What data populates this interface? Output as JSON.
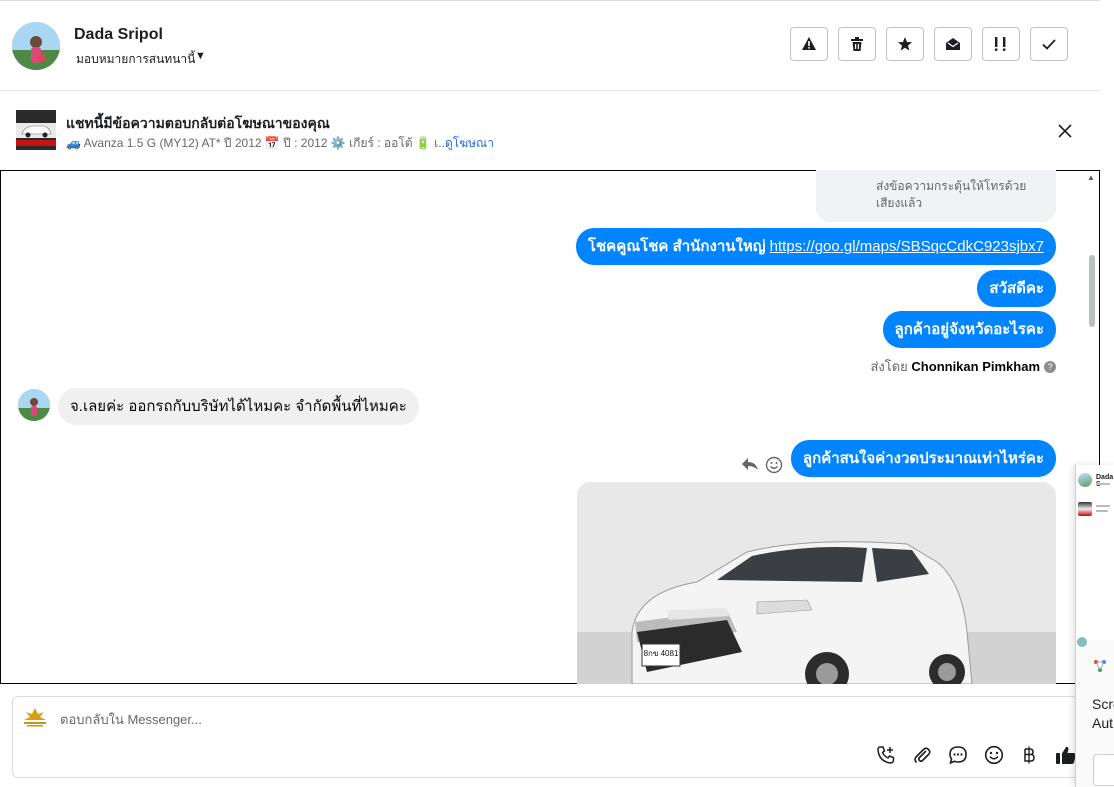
{
  "header": {
    "user_name": "Dada Sripol",
    "assign_label": "มอบหมายการสนทนานี้",
    "toolbar": [
      {
        "name": "spam-button",
        "icon": "warning-icon"
      },
      {
        "name": "delete-button",
        "icon": "trash-icon"
      },
      {
        "name": "star-button",
        "icon": "star-icon"
      },
      {
        "name": "mark-unread-button",
        "icon": "envelope-open-icon"
      },
      {
        "name": "follow-up-button",
        "icon": "exclamation-icon"
      },
      {
        "name": "done-button",
        "icon": "check-icon"
      }
    ]
  },
  "ad_banner": {
    "title": "แชทนี้มีข้อความตอบกลับต่อโฆษณาของคุณ",
    "detail": "🚙 Avanza 1.5 G (MY12) AT* ปี 2012 📅 ปี : 2012 ⚙️ เกียร์ : ออโต้ 🔋 เ...",
    "link": "ดูโฆษณา"
  },
  "chat": {
    "call_card_text": "ส่งข้อความกระตุ้นให้โทรด้วยเสียงแล้ว",
    "messages": [
      {
        "direction": "out",
        "text": "โชคคูณโชค สำนักงานใหญ่ ",
        "link": "https://goo.gl/maps/SBSqcCdkC923sjbx7"
      },
      {
        "direction": "out",
        "text": "สวัสดีคะ"
      },
      {
        "direction": "out",
        "text": "ลูกค้าอยู่จังหวัดอะไรคะ"
      },
      {
        "direction": "in",
        "text": "จ.เลยค่ะ ออกรถกับบริษัทได้ไหมคะ จำกัดพื้นที่ไหมคะ"
      },
      {
        "direction": "out",
        "text": "ลูกค้าสนใจค่างวดประมาณเท่าไหร่คะ"
      }
    ],
    "sent_by_prefix": "ส่งโดย",
    "sent_by_name": "Chonnikan Pimkham",
    "car_plate": "8กข 4081"
  },
  "composer": {
    "placeholder": "ตอบกลับใน Messenger...",
    "icons": [
      "call-add-icon",
      "attachment-icon",
      "saved-reply-icon",
      "emoji-icon",
      "baht-icon",
      "thumbs-up-icon"
    ]
  },
  "side_panel": {
    "name": "Dada S",
    "text_1": "Scre",
    "text_2": "Aut"
  }
}
